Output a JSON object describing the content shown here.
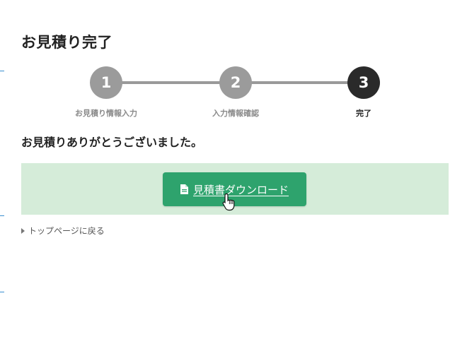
{
  "page": {
    "title": "お見積り完了",
    "thanks_message": "お見積りありがとうございました。"
  },
  "stepper": {
    "steps": [
      {
        "number": "1",
        "label": "お見積り情報入力",
        "state": "done"
      },
      {
        "number": "2",
        "label": "入力情報確認",
        "state": "done"
      },
      {
        "number": "3",
        "label": "完了",
        "state": "active"
      }
    ]
  },
  "download": {
    "button_label": "見積書ダウンロード",
    "icon": "document-icon"
  },
  "back_link": {
    "label": "トップページに戻る"
  },
  "colors": {
    "step_inactive": "#9b9b9b",
    "step_active": "#2a2a2a",
    "panel_bg": "#d5ecd9",
    "button_bg": "#2ea36d"
  }
}
